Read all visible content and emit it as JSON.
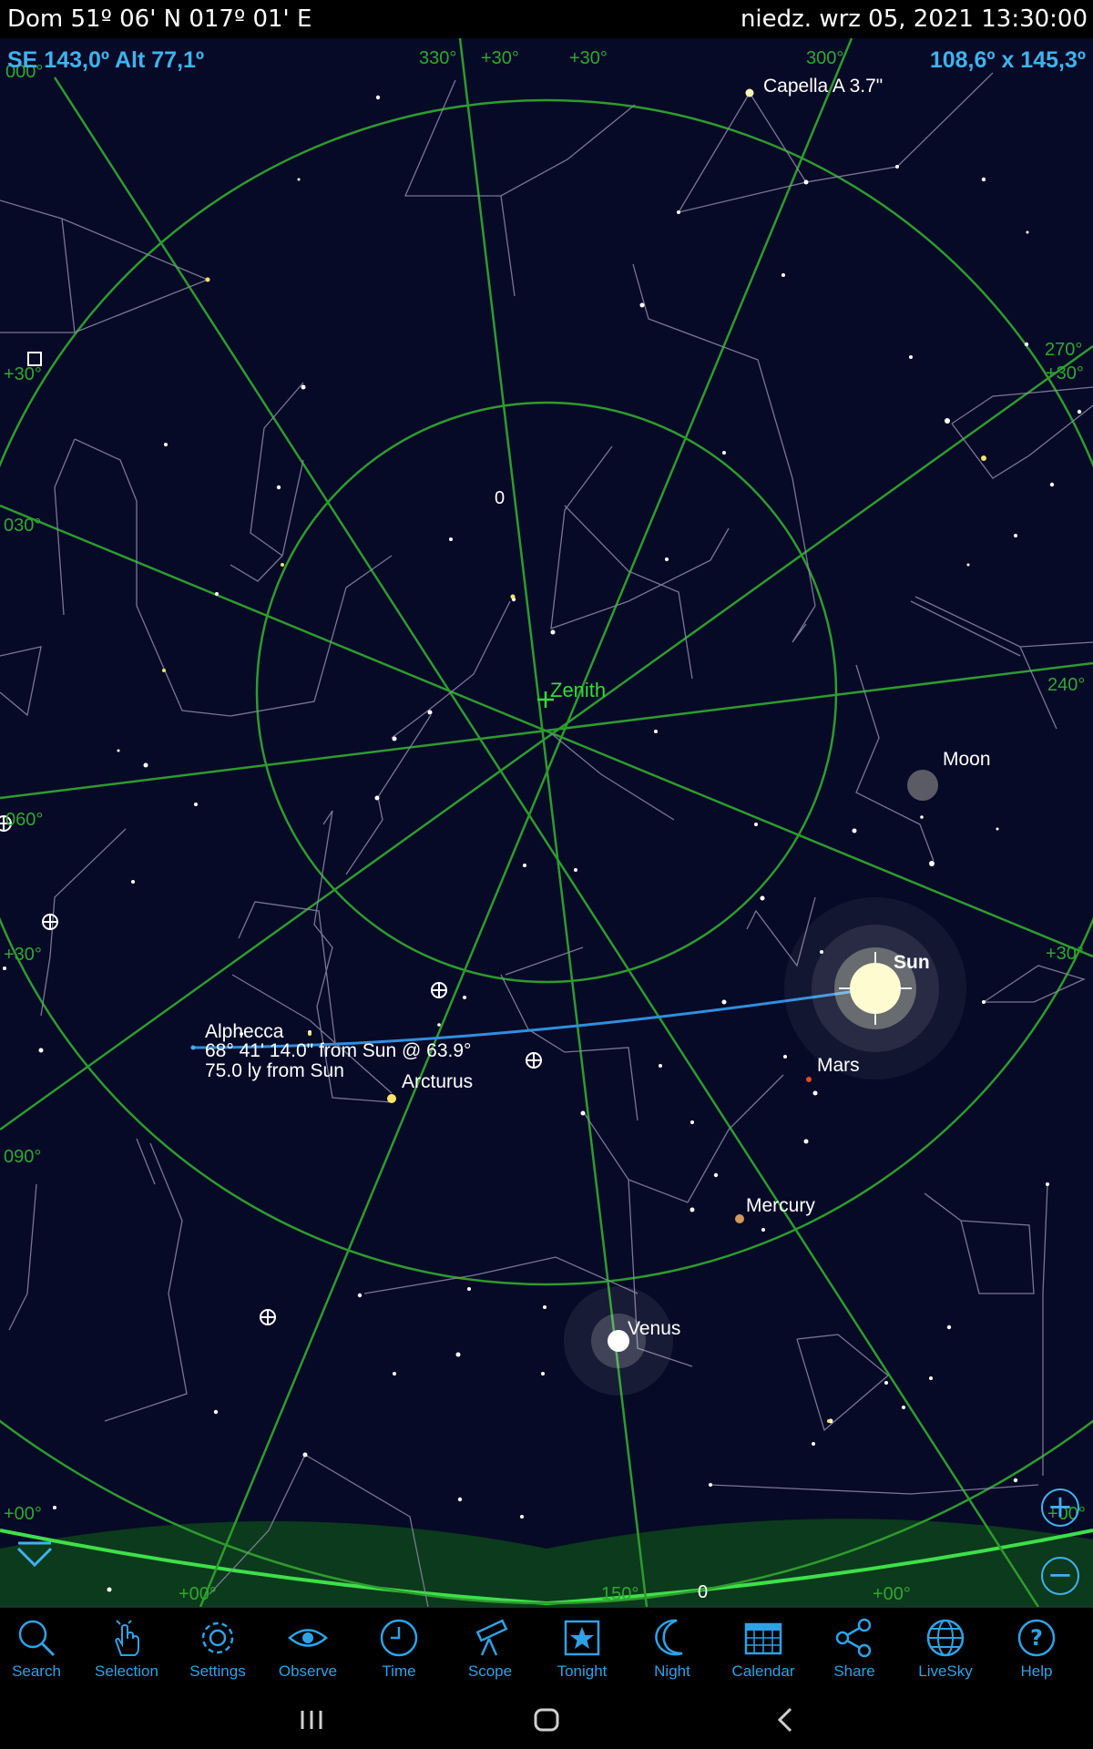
{
  "status_bar": {
    "location": "Dom  51º 06' N 017º 01' E",
    "datetime": "niedz. wrz 05, 2021  13:30:00"
  },
  "view": {
    "direction": "SE 143,0º Alt 77,1º",
    "field_of_view": "108,6º x 145,3º"
  },
  "sky_labels": {
    "zenith": "Zenith",
    "capella": "Capella A 3.7\"",
    "moon": "Moon",
    "sun": "Sun",
    "mars": "Mars",
    "mercury": "Mercury",
    "venus": "Venus",
    "arcturus": "Arcturus",
    "alphecca_line1": "Alphecca",
    "alphecca_line2": "68° 41' 14.0\" from Sun @ 63.9°",
    "alphecca_line3": "75.0 ly from Sun",
    "deep_sky_marker": "0"
  },
  "grid_labels": {
    "az330": "330°",
    "p30_top_a": "+30°",
    "p30_top_b": "+30°",
    "az300": "300°",
    "az000": "000°",
    "az270": "270°",
    "p30_right_a": "+30°",
    "p30_left_a": "+30°",
    "az030": "030°",
    "az240": "240°",
    "az060": "060°",
    "p30_left_b": "+30°",
    "p30_right_b": "+30°",
    "az090": "090°",
    "p00_left": "+00°",
    "p00_right": "+00°",
    "p00_bottom_a": "+00°",
    "az150": "150°",
    "p00_bottom_b": "+00°"
  },
  "zoom": {
    "in": "+",
    "out": "−"
  },
  "toolbar": [
    {
      "label": "Search",
      "icon": "search-icon"
    },
    {
      "label": "Selection",
      "icon": "selection-hand-icon"
    },
    {
      "label": "Settings",
      "icon": "gear-icon"
    },
    {
      "label": "Observe",
      "icon": "eye-icon"
    },
    {
      "label": "Time",
      "icon": "clock-icon"
    },
    {
      "label": "Scope",
      "icon": "telescope-icon"
    },
    {
      "label": "Tonight",
      "icon": "star-box-icon"
    },
    {
      "label": "Night",
      "icon": "moon-icon"
    },
    {
      "label": "Calendar",
      "icon": "calendar-icon"
    },
    {
      "label": "Share",
      "icon": "share-icon"
    },
    {
      "label": "LiveSky",
      "icon": "globe-icon"
    },
    {
      "label": "Help",
      "icon": "help-icon"
    }
  ],
  "colors": {
    "sky": "#070a26",
    "grid": "#2e9b2e",
    "hud": "#3fb2ee",
    "zenith": "#33dd33",
    "toolbar_accent": "#2fa2e6"
  }
}
